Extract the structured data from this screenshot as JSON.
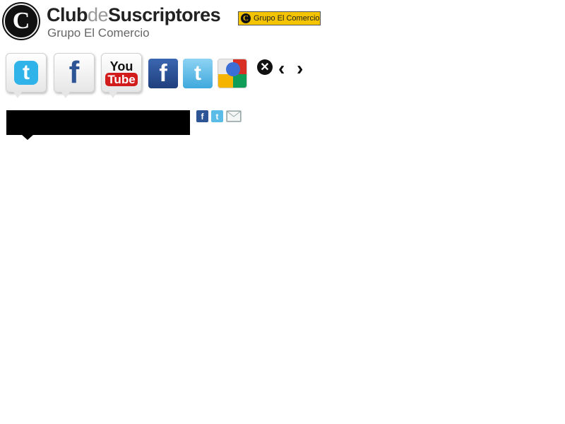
{
  "header": {
    "logo_letter": "C",
    "title_part1": "Club",
    "title_part2": "de",
    "title_part3": "Suscriptores",
    "subtitle": "Grupo El Comercio",
    "badge_letter": "C",
    "badge_text": "Grupo El Comercio"
  },
  "social_bubbles": [
    {
      "name": "twitter",
      "glyph": "t"
    },
    {
      "name": "facebook",
      "glyph": "f"
    },
    {
      "name": "youtube",
      "you": "You",
      "tube": "Tube"
    }
  ],
  "social_squares": [
    {
      "name": "facebook",
      "glyph": "f"
    },
    {
      "name": "twitter",
      "glyph": "t"
    },
    {
      "name": "google",
      "glyph": "g"
    }
  ],
  "controls": {
    "close_glyph": "✕",
    "prev_glyph": "‹",
    "next_glyph": "›"
  },
  "share_mini": [
    {
      "name": "facebook",
      "glyph": "f"
    },
    {
      "name": "twitter",
      "glyph": "t"
    },
    {
      "name": "email",
      "glyph": "✉"
    }
  ],
  "colors": {
    "badge_yellow": "#f5c400",
    "facebook_blue": "#2d5595",
    "twitter_blue": "#2fb3e8",
    "youtube_red": "#d21c1c"
  }
}
